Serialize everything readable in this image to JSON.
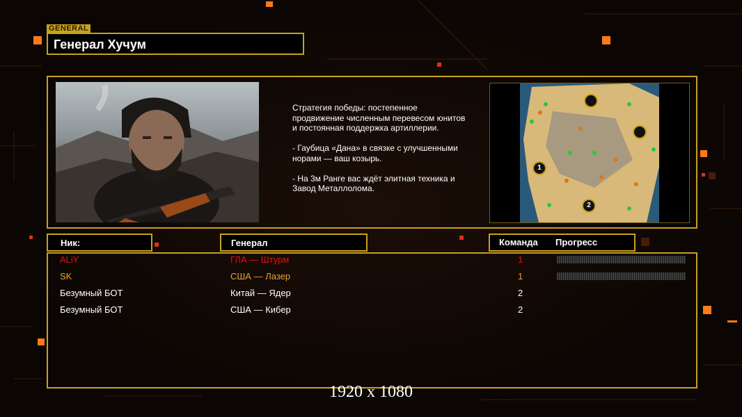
{
  "header": {
    "tag": "GENERAL",
    "title": "Генерал Хучум"
  },
  "description": "Стратегия победы: постепенное продвижение численным перевесом юнитов и постоянная поддержка артиллерии.\n\n- Гаубица «Дана» в связке с улучшенными норами — ваш козырь.\n\n- На 3м Ранге вас ждёт элитная техника и Завод Металлолома.",
  "minimap": {
    "markers": [
      "1",
      "2"
    ]
  },
  "columns": {
    "nick": "Ник:",
    "general": "Генерал",
    "team": "Команда",
    "progress": "Прогресс"
  },
  "players": [
    {
      "nick": "ALiY",
      "general": "ГЛА — Штурм",
      "team": "1",
      "color": "#e01010",
      "progress": 0
    },
    {
      "nick": "SK",
      "general": "США — Лазер",
      "team": "1",
      "color": "#e8a23a",
      "progress": 0
    },
    {
      "nick": "Безумный БОТ",
      "general": "Китай — Ядер",
      "team": "2",
      "color": "#ffffff"
    },
    {
      "nick": "Безумный БОТ",
      "general": "США — Кибер",
      "team": "2",
      "color": "#ffffff"
    }
  ],
  "footer": {
    "resolution": "1920 x 1080"
  },
  "colors": {
    "frame": "#c9a21c",
    "accent_orange": "#ff7a1a"
  }
}
